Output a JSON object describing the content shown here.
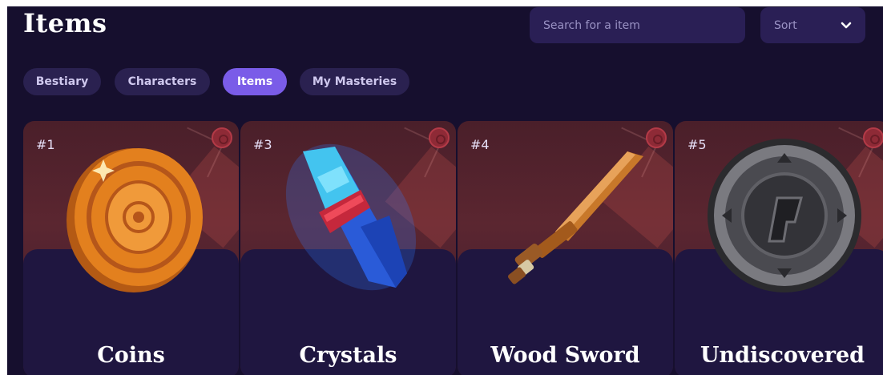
{
  "header": {
    "title": "Items",
    "search_placeholder": "Search for a item",
    "sort_label": "Sort",
    "sort_icon": "chevron-down-icon"
  },
  "tabs": [
    {
      "label": "Bestiary",
      "active": false
    },
    {
      "label": "Characters",
      "active": false
    },
    {
      "label": "Items",
      "active": true
    },
    {
      "label": "My Masteries",
      "active": false
    }
  ],
  "items": [
    {
      "number": "#1",
      "name": "Coins",
      "icon": "coin-icon"
    },
    {
      "number": "#3",
      "name": "Crystals",
      "icon": "crystal-icon"
    },
    {
      "number": "#4",
      "name": "Wood Sword",
      "icon": "wood-sword-icon"
    },
    {
      "number": "#5",
      "name": "Undiscovered",
      "icon": "locked-medallion-icon"
    }
  ],
  "colors": {
    "background": "#160f2e",
    "accent": "#7a5ce8",
    "card_top": "#5b2630",
    "card_panel": "#1f1640"
  }
}
